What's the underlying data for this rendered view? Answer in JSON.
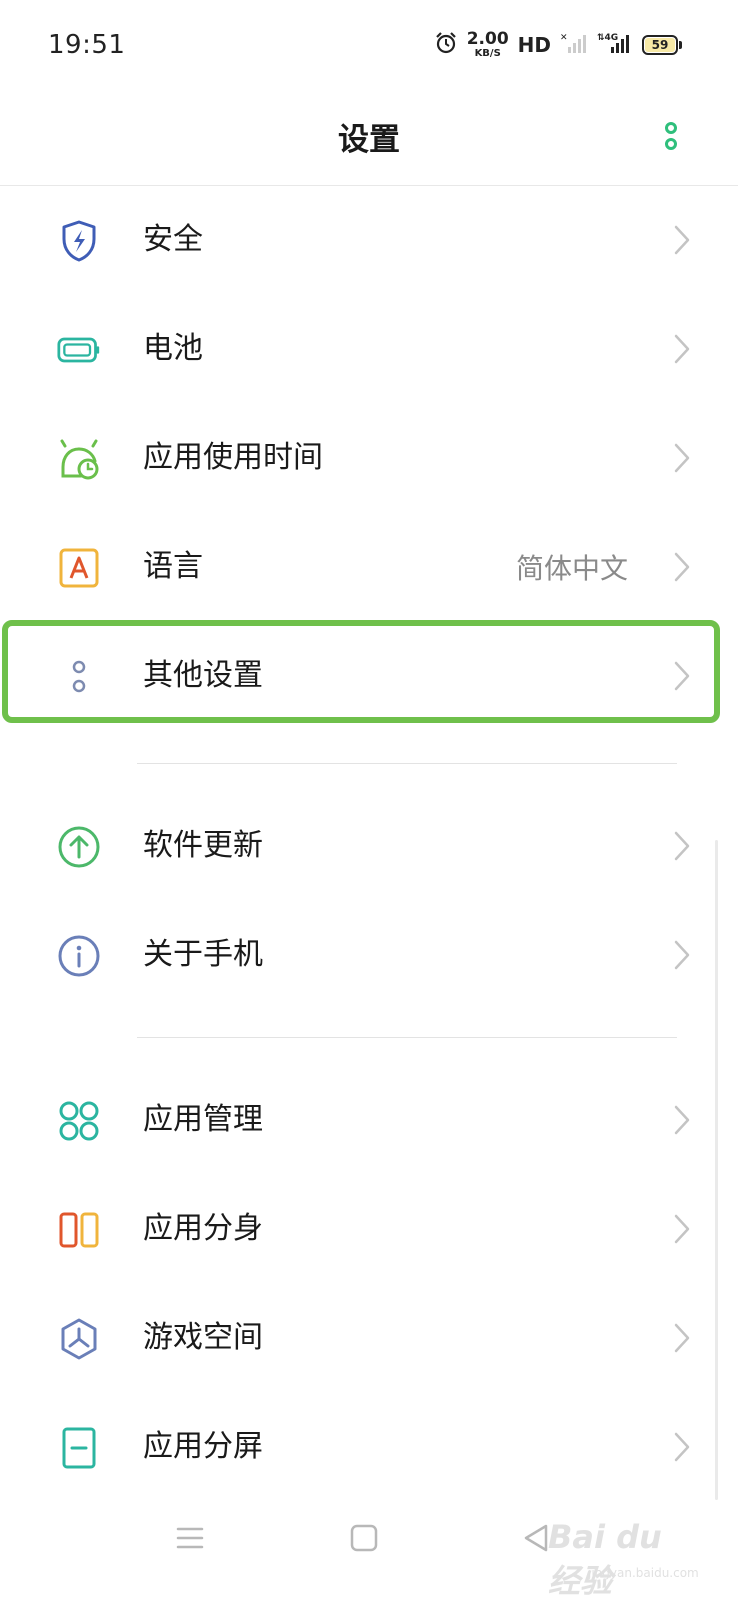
{
  "status_bar": {
    "time": "19:51",
    "speed_value": "2.00",
    "speed_unit": "KB/S",
    "hd_label": "HD",
    "network_label": "4G",
    "battery_level": "59",
    "icons": [
      "alarm-icon",
      "signal-icon",
      "battery-icon"
    ]
  },
  "header": {
    "title": "设置",
    "accent_color": "#2fbf7c"
  },
  "items": [
    {
      "label": "安全",
      "icon": "security-shield-icon",
      "color": "#3f5db6"
    },
    {
      "label": "电池",
      "icon": "battery-icon",
      "color": "#2bb5a0"
    },
    {
      "label": "应用使用时间",
      "icon": "app-usage-timer-icon",
      "color": "#6abf4b"
    },
    {
      "label": "语言",
      "icon": "language-icon",
      "value": "简体中文",
      "color": "#e89a2c"
    },
    {
      "label": "其他设置",
      "icon": "other-settings-icon",
      "color": "#7d8bb0"
    },
    {
      "label": "软件更新",
      "icon": "software-update-icon",
      "color": "#4cb86a"
    },
    {
      "label": "关于手机",
      "icon": "about-phone-icon",
      "color": "#6a7fb8"
    },
    {
      "label": "应用管理",
      "icon": "app-management-icon",
      "color": "#2bb5a0"
    },
    {
      "label": "应用分身",
      "icon": "app-clone-icon",
      "color": "#e06a2c"
    },
    {
      "label": "游戏空间",
      "icon": "game-space-icon",
      "color": "#6a7fb8"
    },
    {
      "label": "应用分屏",
      "icon": "split-screen-icon",
      "color": "#2bb5a0"
    }
  ],
  "highlight_color": "#6fc04b",
  "nav": {
    "menu": "menu-icon",
    "home": "home-icon",
    "back": "back-icon"
  },
  "watermark": {
    "text": "Bai du 经验",
    "sub": "jingyan.baidu.com"
  }
}
